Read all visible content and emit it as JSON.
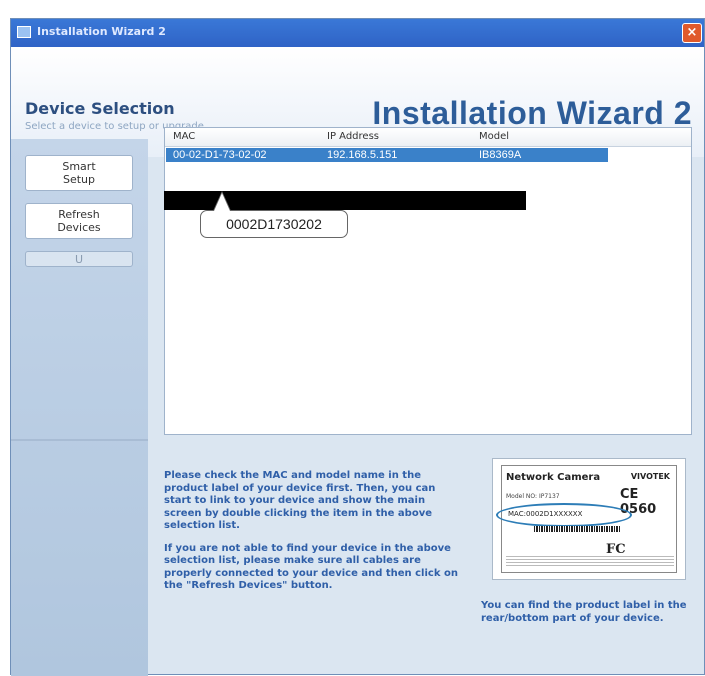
{
  "window": {
    "title": "Installation Wizard 2",
    "close_glyph": "×"
  },
  "header": {
    "heading": "Device Selection",
    "subheading": "Select a device to setup or upgrade",
    "app_title": "Installation Wizard 2"
  },
  "sidebar": {
    "smart_setup": "Smart Setup",
    "refresh_devices": "Refresh Devices",
    "disabled_button": "U"
  },
  "device_list": {
    "columns": [
      "MAC",
      "IP Address",
      "Model"
    ],
    "rows": [
      {
        "mac": "00-02-D1-73-02-02",
        "ip": "192.168.5.151",
        "model": "IB8369A"
      }
    ]
  },
  "callout": {
    "text": "0002D1730202"
  },
  "instructions": {
    "para1": "Please check the MAC and model name in the product label of your device first. Then, you can start to link to your device and show the main screen by double clicking the item in the above selection list.",
    "para2": "If you are not able to find your device in the above selection list, please make sure all cables are properly connected to your device and then click on the \"Refresh Devices\" button."
  },
  "product_label": {
    "title": "Network Camera",
    "brand": "VIVOTEK",
    "model_no": "Model NO: IP7137",
    "ce": "CE 0560",
    "mac": "MAC:0002D1XXXXXX",
    "fc": "FC",
    "caption": "You can find the product label in the rear/bottom part of your device."
  },
  "colors": {
    "accent": "#2f5fa8",
    "selection": "#3a81c9",
    "titlebar": "#3a78d7"
  }
}
